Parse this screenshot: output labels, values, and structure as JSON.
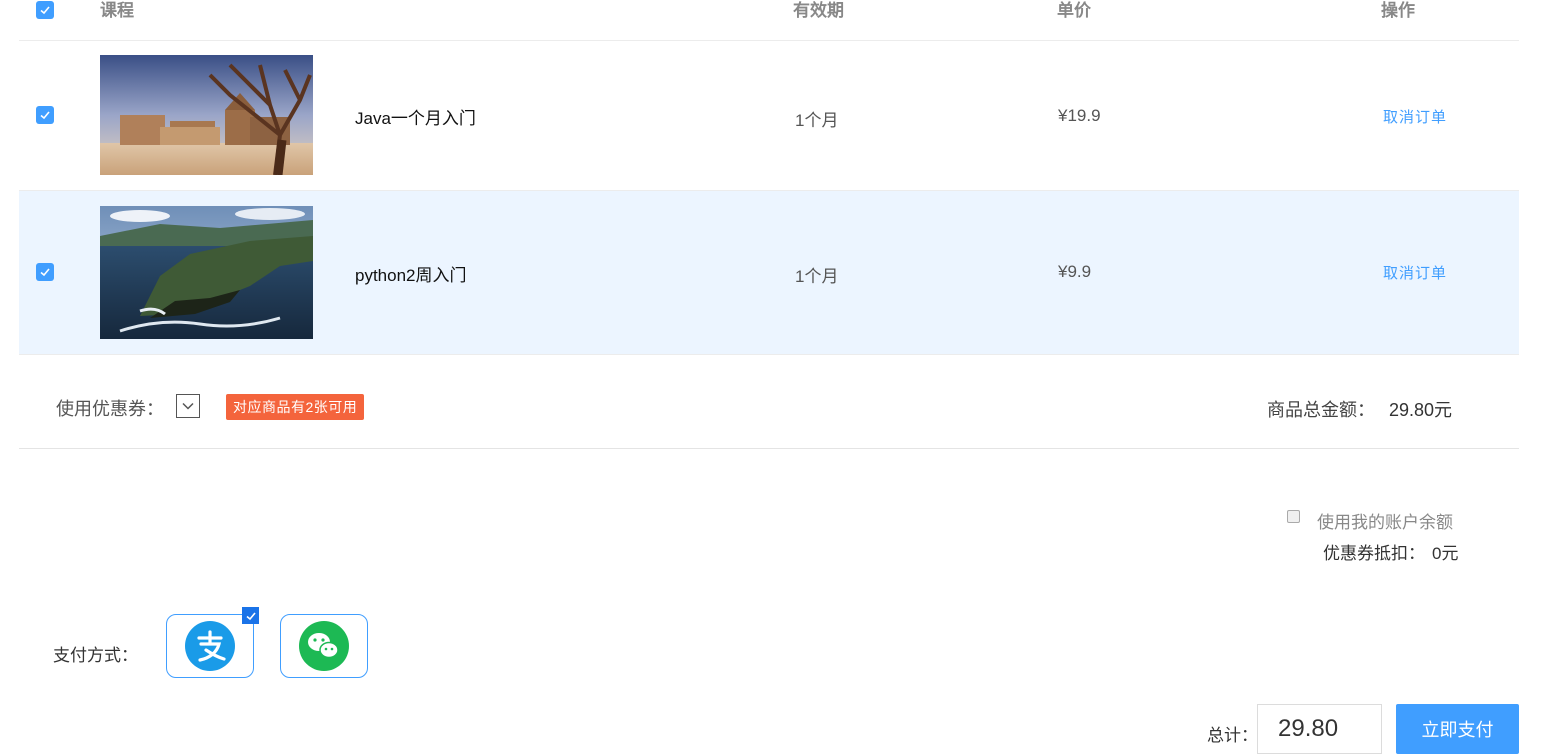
{
  "header": {
    "course": "课程",
    "validity": "有效期",
    "price": "单价",
    "action": "操作"
  },
  "orders": [
    {
      "name": "Java一个月入门",
      "validity": "1个月",
      "price": "¥19.9",
      "action": "取消订单",
      "image": "temple-ruins-photo"
    },
    {
      "name": "python2周入门",
      "validity": "1个月",
      "price": "¥9.9",
      "action": "取消订单",
      "image": "coastal-cliffs-photo"
    }
  ],
  "coupon": {
    "label": "使用优惠券：",
    "badge": "对应商品有2张可用",
    "total_label": "商品总金额：",
    "total_value": "29.80元"
  },
  "balance": {
    "label": "使用我的账户余额",
    "discount_label": "优惠券抵扣：",
    "discount_value": "0元"
  },
  "payment": {
    "label": "支付方式：",
    "methods": [
      {
        "name": "alipay",
        "selected": true
      },
      {
        "name": "wechat-pay",
        "selected": false
      }
    ]
  },
  "footer": {
    "total_label": "总计：",
    "total_value": "29.80",
    "pay_button": "立即支付"
  },
  "colors": {
    "accent": "#409eff",
    "badge": "#f4643c",
    "row_highlight": "#ecf5ff",
    "alipay": "#1a9be8",
    "wechat": "#1db954"
  }
}
